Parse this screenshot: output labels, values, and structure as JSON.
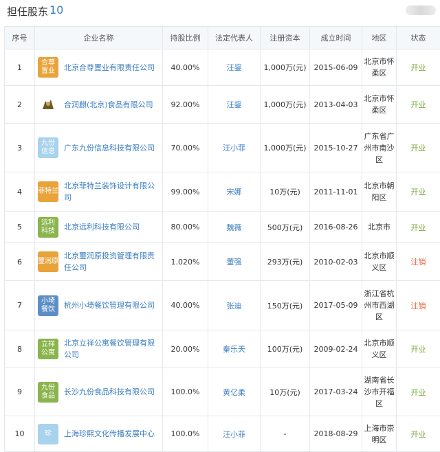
{
  "header": {
    "title": "担任股东",
    "count": "10"
  },
  "columns": [
    "序号",
    "企业名称",
    "持股比例",
    "法定代表人",
    "注册资本",
    "成立时间",
    "地区",
    "状态"
  ],
  "rows": [
    {
      "no": "1",
      "logo": "合尊置业",
      "logo_color": "#e9a33b",
      "name": "北京合尊置业有限责任公司",
      "ratio": "40.00%",
      "legal": "汪鋆",
      "capital": "1,000万(元)",
      "date": "2015-06-09",
      "region": "北京市怀柔区",
      "status": "开业"
    },
    {
      "no": "2",
      "logo": "",
      "logo_color": "#ffffff",
      "name": "合润麒(北京)食品有限公司",
      "ratio": "92.00%",
      "legal": "汪鋆",
      "capital": "1,000万(元)",
      "date": "2013-04-03",
      "region": "北京市怀柔区",
      "status": "开业"
    },
    {
      "no": "3",
      "logo": "九份信息",
      "logo_color": "#a9d2ec",
      "name": "广东九份信息科技有限公司",
      "ratio": "70.00%",
      "legal": "汪小菲",
      "capital": "1,000万(元)",
      "date": "2015-10-27",
      "region": "广东省广州市南沙区",
      "status": "开业"
    },
    {
      "no": "4",
      "logo": "菲特兰",
      "logo_color": "#e9a33b",
      "name": "北京菲特兰装饰设计有限公司",
      "ratio": "99.00%",
      "legal": "宋娜",
      "capital": "10万(元)",
      "date": "2011-11-01",
      "region": "北京市朝阳区",
      "status": "开业"
    },
    {
      "no": "5",
      "logo": "远利科技",
      "logo_color": "#8ab44c",
      "name": "北京远利科技有限公司",
      "ratio": "80.00%",
      "legal": "魏薇",
      "capital": "500万(元)",
      "date": "2016-08-26",
      "region": "北京市",
      "status": "开业"
    },
    {
      "no": "6",
      "logo": "璽润原",
      "logo_color": "#e9a33b",
      "name": "北京璽润原投资管理有限责任公司",
      "ratio": "1.020%",
      "legal": "董强",
      "capital": "293万(元)",
      "date": "2010-02-03",
      "region": "北京市顺义区",
      "status": "注销"
    },
    {
      "no": "7",
      "logo": "小埼餐饮",
      "logo_color": "#5d8fc7",
      "name": "杭州小埼餐饮管理有限公司",
      "ratio": "40.00%",
      "legal": "张迪",
      "capital": "150万(元)",
      "date": "2017-05-09",
      "region": "浙江省杭州市西湖区",
      "status": "注销"
    },
    {
      "no": "8",
      "logo": "立祥公寓",
      "logo_color": "#8ab44c",
      "name": "北京立祥公寓餐饮管理有限公司",
      "ratio": "20.00%",
      "legal": "秦乐天",
      "capital": "100万(元)",
      "date": "2009-02-24",
      "region": "北京市顺义区",
      "status": "开业"
    },
    {
      "no": "9",
      "logo": "九份食品",
      "logo_color": "#8ab44c",
      "name": "长沙九份食品科技有限公司",
      "ratio": "100.0%",
      "legal": "黄亿柔",
      "capital": "10万(元)",
      "date": "2017-03-24",
      "region": "湖南省长沙市开福区",
      "status": "开业"
    },
    {
      "no": "10",
      "logo": "珍",
      "logo_color": "#a9d2ec",
      "name": "上海珍熙文化传播发展中心",
      "ratio": "100.0%",
      "legal": "汪小菲",
      "capital": "-",
      "date": "2018-08-29",
      "region": "上海市崇明区",
      "status": "开业"
    }
  ]
}
